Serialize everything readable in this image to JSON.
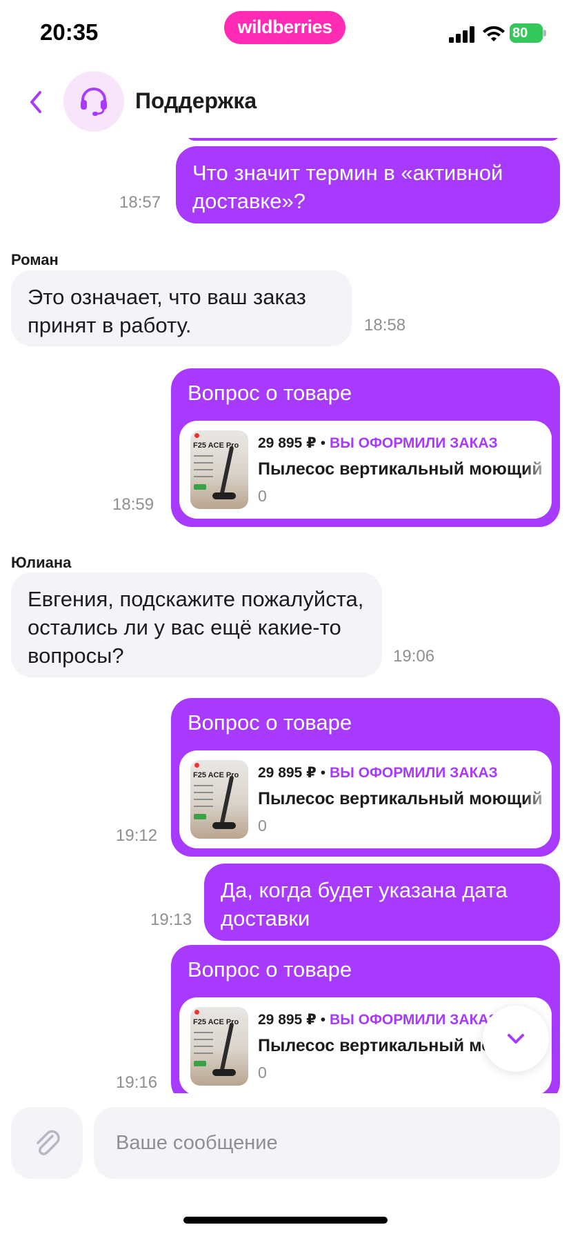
{
  "status_bar": {
    "time": "20:35",
    "brand": "wildberries",
    "battery": "80",
    "icons": [
      "signal-icon",
      "wifi-icon",
      "battery-icon"
    ]
  },
  "header": {
    "title": "Поддержка",
    "back_icon": "chevron-left-icon",
    "avatar_icon": "headset-icon"
  },
  "messages": [
    {
      "type": "outgoing",
      "text": "Что значит термин в «активной доставке»?",
      "time": "18:57"
    },
    {
      "type": "incoming",
      "sender": "Роман",
      "text": "Это означает, что ваш заказ принят в работу.",
      "time": "18:58"
    },
    {
      "type": "product",
      "heading": "Вопрос о товаре",
      "price": "29 895 ₽",
      "status": "ВЫ ОФОРМИЛИ ЗАКАЗ",
      "name": "Пылесос вертикальный моющий",
      "count": "0",
      "thumb_model": "F25 ACE Pro",
      "time": "18:59"
    },
    {
      "type": "incoming",
      "sender": "Юлиана",
      "text": "Евгения, подскажите пожалуйста, остались ли у вас ещё какие-то вопросы?",
      "time": "19:06"
    },
    {
      "type": "product",
      "heading": "Вопрос о товаре",
      "price": "29 895 ₽",
      "status": "ВЫ ОФОРМИЛИ ЗАКАЗ",
      "name": "Пылесос вертикальный моющий",
      "count": "0",
      "thumb_model": "F25 ACE Pro",
      "time": "19:12"
    },
    {
      "type": "outgoing",
      "text": "Да, когда будет указана дата доставки",
      "time": "19:13"
    },
    {
      "type": "product",
      "heading": "Вопрос о товаре",
      "price": "29 895 ₽",
      "status": "ВЫ ОФОРМИЛИ ЗАКАЗ",
      "name": "Пылесос вертикальный моющий",
      "count": "0",
      "thumb_model": "F25 ACE Pro",
      "time": "19:16"
    }
  ],
  "composer": {
    "placeholder": "Ваше сообщение",
    "attach_icon": "paperclip-icon"
  },
  "scroll_down_icon": "chevron-down-icon",
  "colors": {
    "accent": "#a73afd",
    "brand_pink": "#ff2bb4",
    "incoming_bubble": "#f4f3f8",
    "battery_green": "#34c759"
  }
}
